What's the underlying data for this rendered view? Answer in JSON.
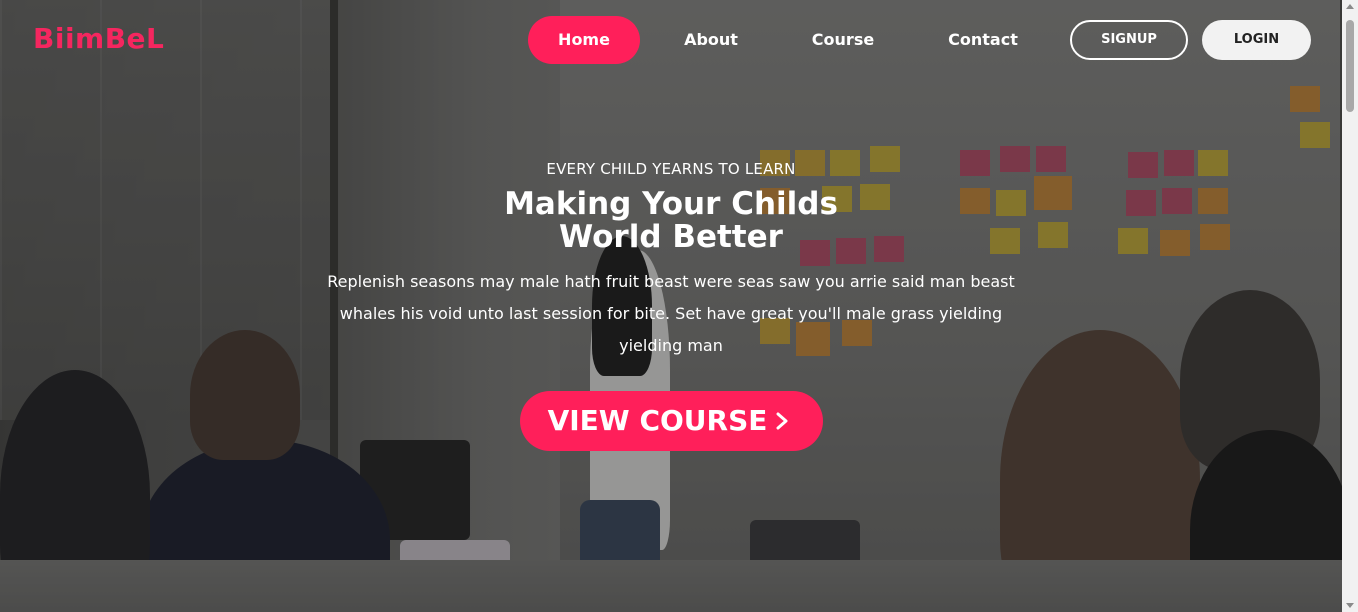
{
  "brand": {
    "logo_text": "BiimBeL",
    "accent_color": "#ff1f5a",
    "logo_color": "#f5265f"
  },
  "nav": {
    "items": [
      {
        "label": "Home",
        "active": true
      },
      {
        "label": "About",
        "active": false
      },
      {
        "label": "Course",
        "active": false
      },
      {
        "label": "Contact",
        "active": false
      }
    ],
    "signup_label": "SIGNUP",
    "login_label": "LOGIN"
  },
  "hero": {
    "eyebrow": "EVERY CHILD YEARNS TO LEARN",
    "title_line1": "Making Your Childs",
    "title_line2": "World Better",
    "description": "Replenish seasons may male hath fruit beast were seas saw you arrie said man beast whales his void unto last session for bite. Set have great you'll male grass yielding yielding man",
    "cta_label": "VIEW COURSE",
    "cta_icon": "chevron-right-icon"
  }
}
